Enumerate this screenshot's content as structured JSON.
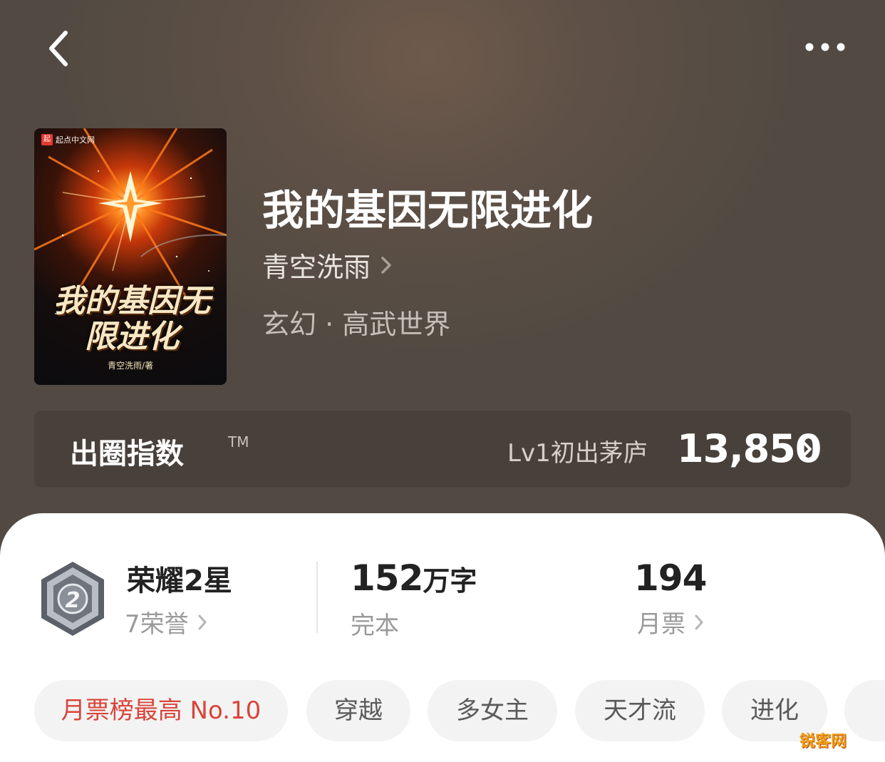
{
  "book": {
    "title": "我的基因无限进化",
    "author": "青空洗雨",
    "genre": "玄幻 · 高武世界"
  },
  "cover": {
    "brand": "起点中文网",
    "title": "我的基因无限进化",
    "author_credit": "青空洗雨/著"
  },
  "index_card": {
    "label": "出圈指数",
    "tm": "TM",
    "level": "Lv1初出茅庐",
    "value": "13,850"
  },
  "stats": {
    "honor_title": "荣耀2星",
    "honor_sub": "7荣誉",
    "medal_number": "2",
    "words_num": "152",
    "words_unit": "万字",
    "status": "完本",
    "tickets_value": "194",
    "tickets_label": "月票"
  },
  "tags": [
    "月票榜最高 No.10",
    "穿越",
    "多女主",
    "天才流",
    "进化"
  ],
  "watermark": "锐客网",
  "colors": {
    "header_bg": "#5e5046",
    "index_card_bg": "#48403a",
    "highlight_tag": "#d8443a",
    "tag_bg": "#f3f3f3"
  },
  "icons": [
    "back-chevron-icon",
    "more-dots-icon",
    "chevron-right-icon",
    "medal-icon"
  ]
}
